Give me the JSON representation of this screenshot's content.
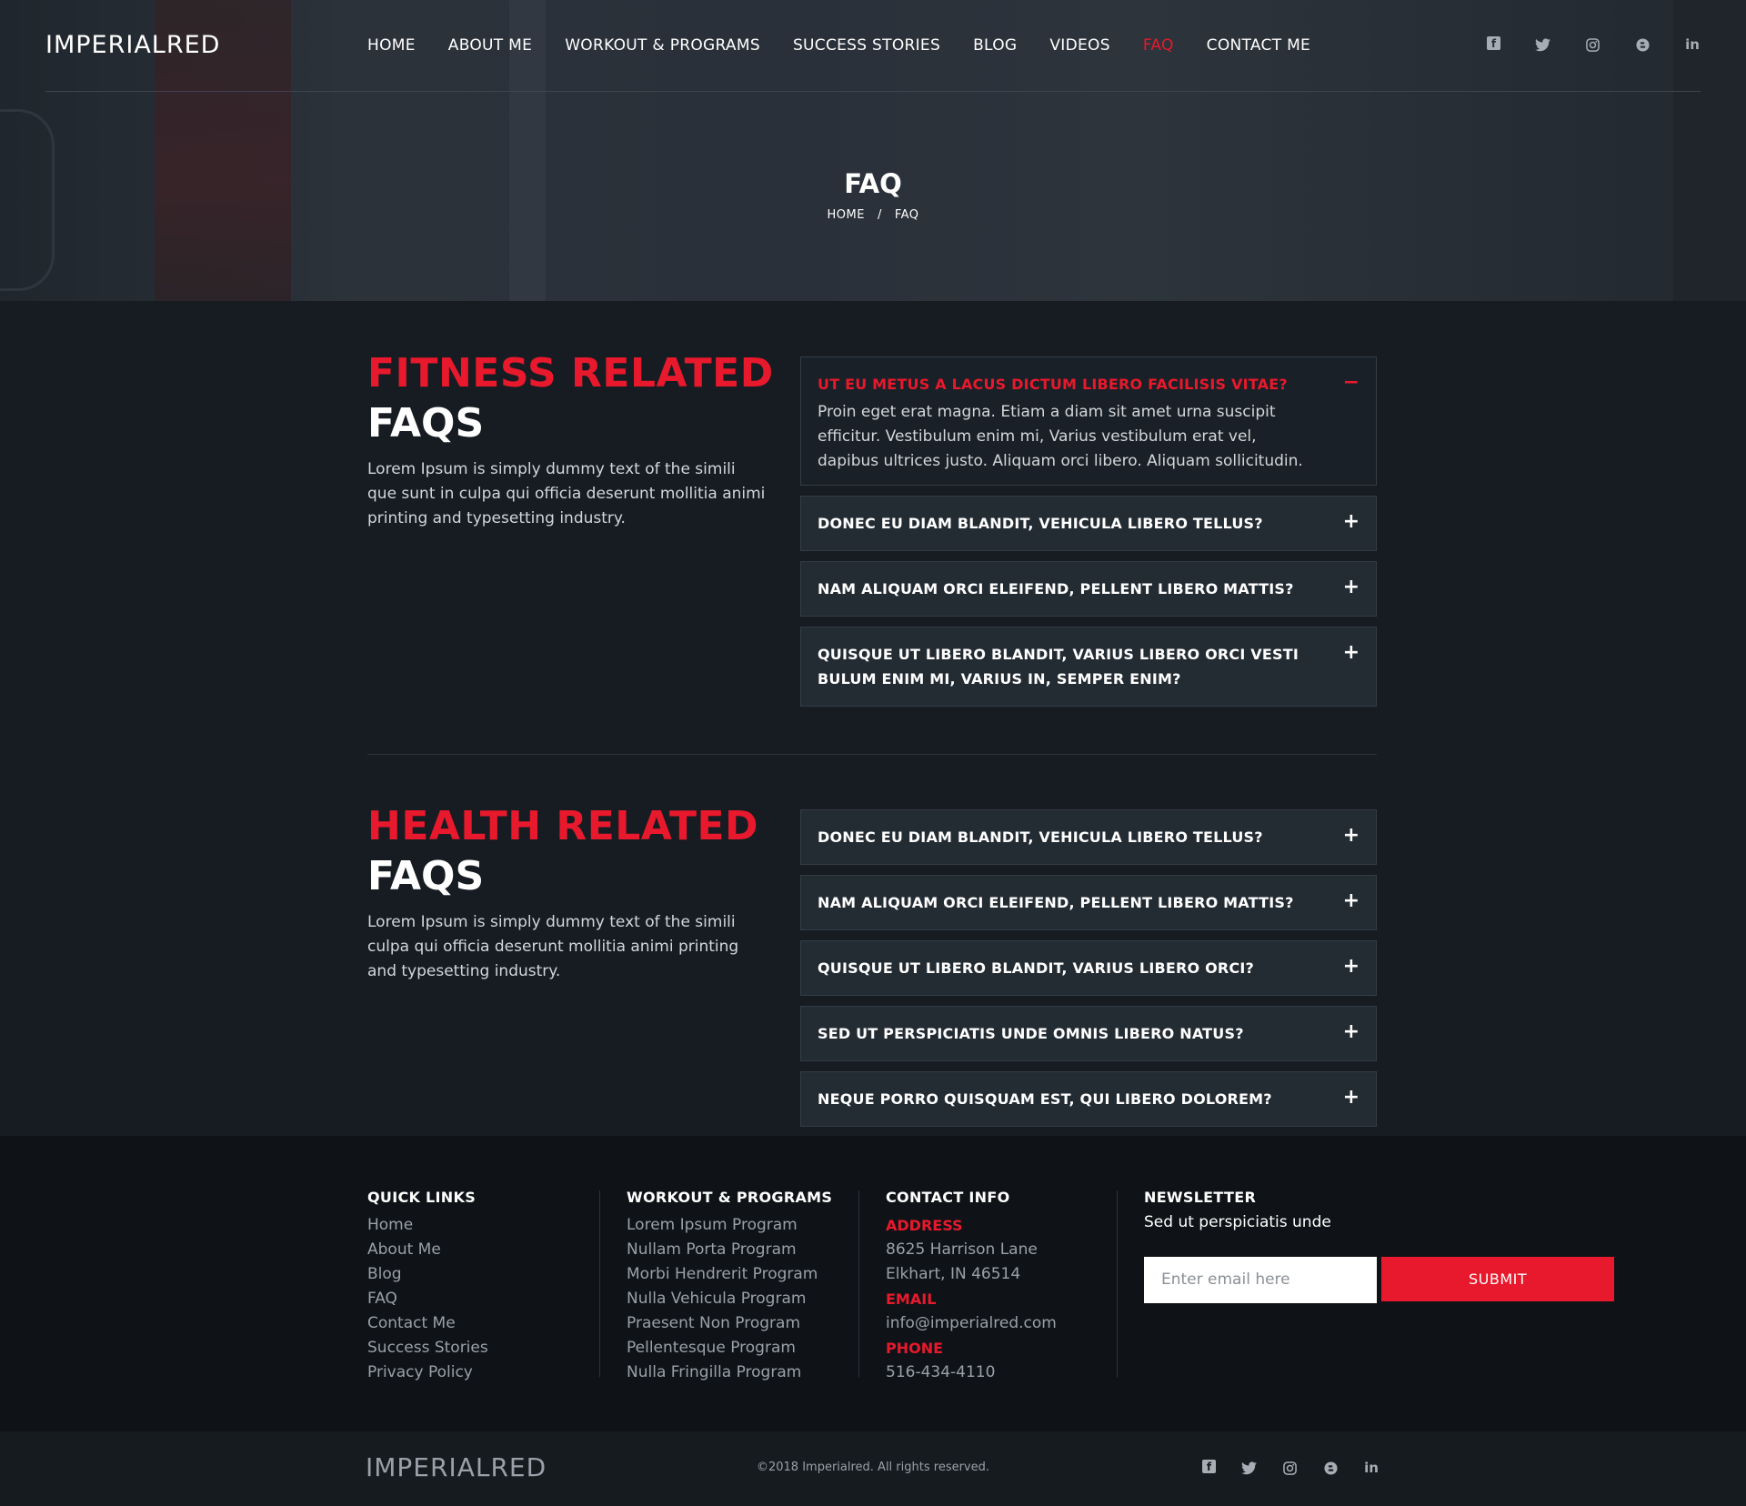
{
  "header": {
    "logo": "IMPERIALRED",
    "nav": [
      "HOME",
      "ABOUT ME",
      "WORKOUT & PROGRAMS",
      "SUCCESS STORIES",
      "BLOG",
      "VIDEOS",
      "FAQ",
      "CONTACT ME"
    ],
    "active_nav": "FAQ",
    "social_icons": [
      "facebook-icon",
      "twitter-icon",
      "instagram-icon",
      "blogger-icon",
      "linkedin-icon"
    ]
  },
  "hero": {
    "title": "FAQ",
    "breadcrumb": [
      "HOME",
      "/",
      "FAQ"
    ]
  },
  "fitness": {
    "heading_line1": "FITNESS RELATED",
    "heading_line2": "FAQS",
    "description": "Lorem Ipsum is simply dummy text of the simili que sunt in culpa qui officia deserunt mollitia animi printing and typesetting industry.",
    "items": [
      {
        "question": "UT EU METUS A LACUS DICTUM LIBERO FACILISIS VITAE?",
        "answer": "Proin eget erat magna. Etiam a diam sit amet urna suscipit efficitur. Vestibulum enim mi, Varius vestibulum erat vel, dapibus ultrices justo. Aliquam orci libero. Aliquam sollicitudin.",
        "open": true,
        "sign": "−"
      },
      {
        "question": "DONEC EU DIAM BLANDIT, VEHICULA LIBERO TELLUS?",
        "sign": "+"
      },
      {
        "question": "NAM ALIQUAM ORCI ELEIFEND, PELLENT LIBERO MATTIS?",
        "sign": "+"
      },
      {
        "question": "QUISQUE UT LIBERO BLANDIT, VARIUS LIBERO ORCI VESTI BULUM ENIM MI, VARIUS IN, SEMPER ENIM?",
        "sign": "+"
      }
    ]
  },
  "health": {
    "heading_line1": "HEALTH RELATED",
    "heading_line2": "FAQS",
    "description": "Lorem Ipsum is simply dummy text of the simili culpa qui officia deserunt mollitia animi printing and typesetting industry.",
    "items": [
      {
        "question": "DONEC EU DIAM BLANDIT, VEHICULA LIBERO TELLUS?",
        "sign": "+"
      },
      {
        "question": "NAM ALIQUAM ORCI ELEIFEND, PELLENT LIBERO MATTIS?",
        "sign": "+"
      },
      {
        "question": "QUISQUE UT LIBERO BLANDIT, VARIUS LIBERO ORCI?",
        "sign": "+"
      },
      {
        "question": "SED UT PERSPICIATIS UNDE OMNIS LIBERO NATUS?",
        "sign": "+"
      },
      {
        "question": "NEQUE PORRO QUISQUAM EST, QUI LIBERO DOLOREM?",
        "sign": "+"
      }
    ]
  },
  "footer": {
    "quick_links": {
      "title": "QUICK LINKS",
      "links": [
        "Home",
        "About Me",
        "Blog",
        "FAQ",
        "Contact Me",
        "Success Stories",
        "Privacy Policy"
      ]
    },
    "programs": {
      "title": "WORKOUT & PROGRAMS",
      "links": [
        "Lorem Ipsum Program",
        "Nullam Porta Program",
        "Morbi Hendrerit Program",
        "Nulla Vehicula Program",
        "Praesent Non Program",
        "Pellentesque Program",
        "Nulla Fringilla Program"
      ]
    },
    "contact": {
      "title": "CONTACT INFO",
      "address_label": "ADDRESS",
      "address_line1": "8625 Harrison Lane",
      "address_line2": "Elkhart, IN 46514",
      "email_label": "EMAIL",
      "email": "info@imperialred.com",
      "phone_label": "PHONE",
      "phone": "516-434-4110"
    },
    "newsletter": {
      "title": "NEWSLETTER",
      "text": "Sed ut perspiciatis unde",
      "placeholder": "Enter email here",
      "button": "SUBMIT"
    }
  },
  "bottom": {
    "logo": "IMPERIALRED",
    "copyright": "©2018 Imperialred. All rights reserved."
  },
  "colors": {
    "accent": "#e8192c",
    "background": "#171c22",
    "footer": "#0f1317"
  }
}
